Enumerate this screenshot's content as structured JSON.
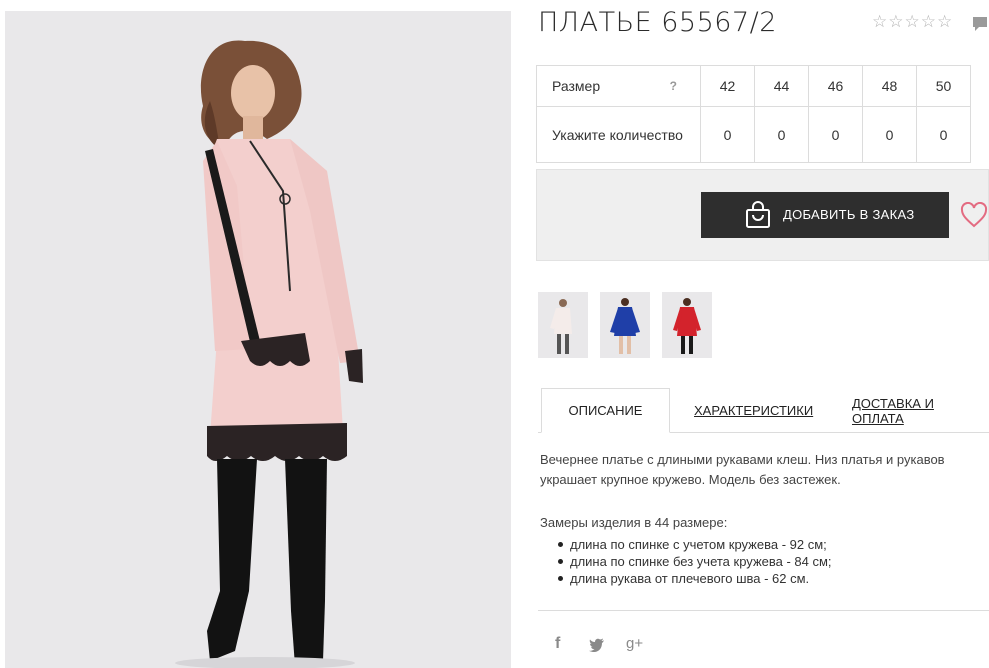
{
  "product": {
    "title": "ПЛАТЬЕ 65567/2",
    "rating_stars": [
      "☆",
      "☆",
      "☆",
      "☆",
      "☆"
    ]
  },
  "sizes": {
    "size_label": "Размер",
    "help_mark": "?",
    "values": [
      "42",
      "44",
      "46",
      "48",
      "50"
    ],
    "qty_label": "Укажите количество",
    "quantities": [
      "0",
      "0",
      "0",
      "0",
      "0"
    ]
  },
  "order": {
    "button_label": "ДОБАВИТЬ В ЗАКАЗ",
    "heart_color": "#e36b81"
  },
  "thumbnails": [
    {
      "color": "#f1e6e4"
    },
    {
      "color": "#1f3fa8"
    },
    {
      "color": "#d3232c"
    }
  ],
  "tabs": [
    {
      "label": "ОПИСАНИЕ",
      "active": true
    },
    {
      "label": "ХАРАКТЕРИСТИКИ",
      "active": false
    },
    {
      "label": "ДОСТАВКА И ОПЛАТА",
      "active": false
    }
  ],
  "description": {
    "text": "Вечернее платье с длиными рукавами клеш. Низ платья и рукавов украшает крупное кружево. Модель без застежек.",
    "measure_title": "Замеры изделия в 44 размере:",
    "measures": [
      "длина по спинке с учетом кружева - 92 см;",
      "длина по спинке без учета кружева - 84 см;",
      "длина рукава от плечевого шва - 62 см."
    ]
  },
  "social": {
    "facebook": "f",
    "twitter": "twitter-icon",
    "google_plus": "g+"
  }
}
